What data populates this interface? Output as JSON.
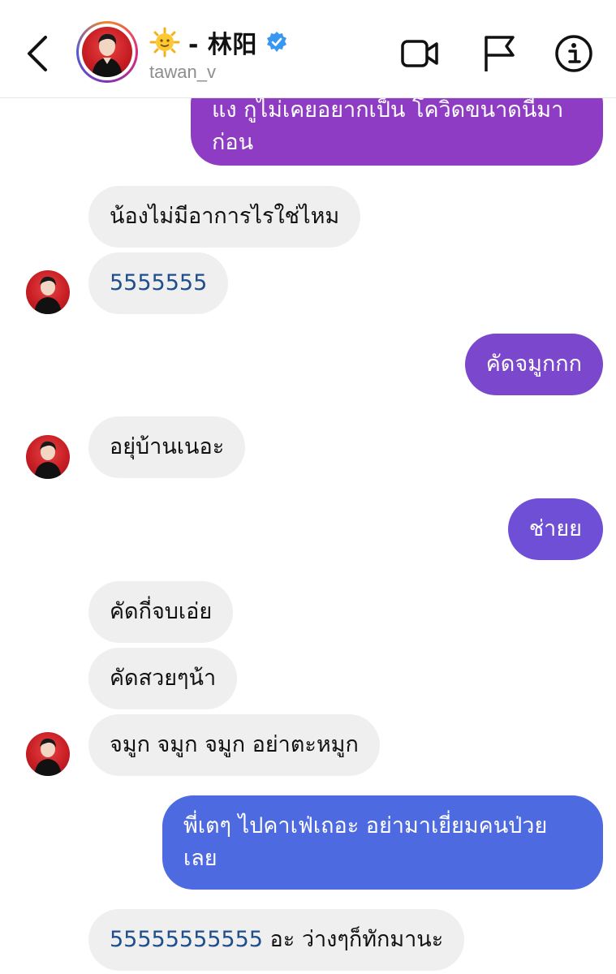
{
  "header": {
    "title": "- 林阳",
    "username": "tawan_v",
    "icons": [
      "back-icon",
      "avatar",
      "sun-emoji-icon",
      "verified-icon",
      "video-call-icon",
      "flag-icon",
      "info-icon"
    ]
  },
  "messages": [
    {
      "side": "out",
      "text": "แง กูไม่เคยอยากเป็น โควิดขนาดนี้มา ก่อน",
      "color": "#8e3cc4"
    },
    {
      "side": "in",
      "text": "น้องไม่มีอาการไรใช่ไหม"
    },
    {
      "side": "in",
      "text": "5555555"
    },
    {
      "side": "out",
      "text": "คัดจมูกกก",
      "color": "#7b47cc"
    },
    {
      "side": "in",
      "text": "อยุ่บ้านเนอะ"
    },
    {
      "side": "out",
      "text": "ช่ายย",
      "color": "#6e4fd6"
    },
    {
      "side": "in",
      "text": "คัดกี่จบเอ่ย"
    },
    {
      "side": "in",
      "text": "คัดสวยๆน้า"
    },
    {
      "side": "in",
      "text": "จมูก จมูก จมูก อย่าตะหมูก"
    },
    {
      "side": "out",
      "text": "พี่เตๆ ไปคาเฟ่เถอะ อย่ามาเยี่ยมคนป่วย เลย",
      "color": "#4d6ae0"
    },
    {
      "side": "in",
      "text_num": "55555555555",
      "text_rest": " อะ ว่างๆก็ทักมานะ"
    }
  ]
}
